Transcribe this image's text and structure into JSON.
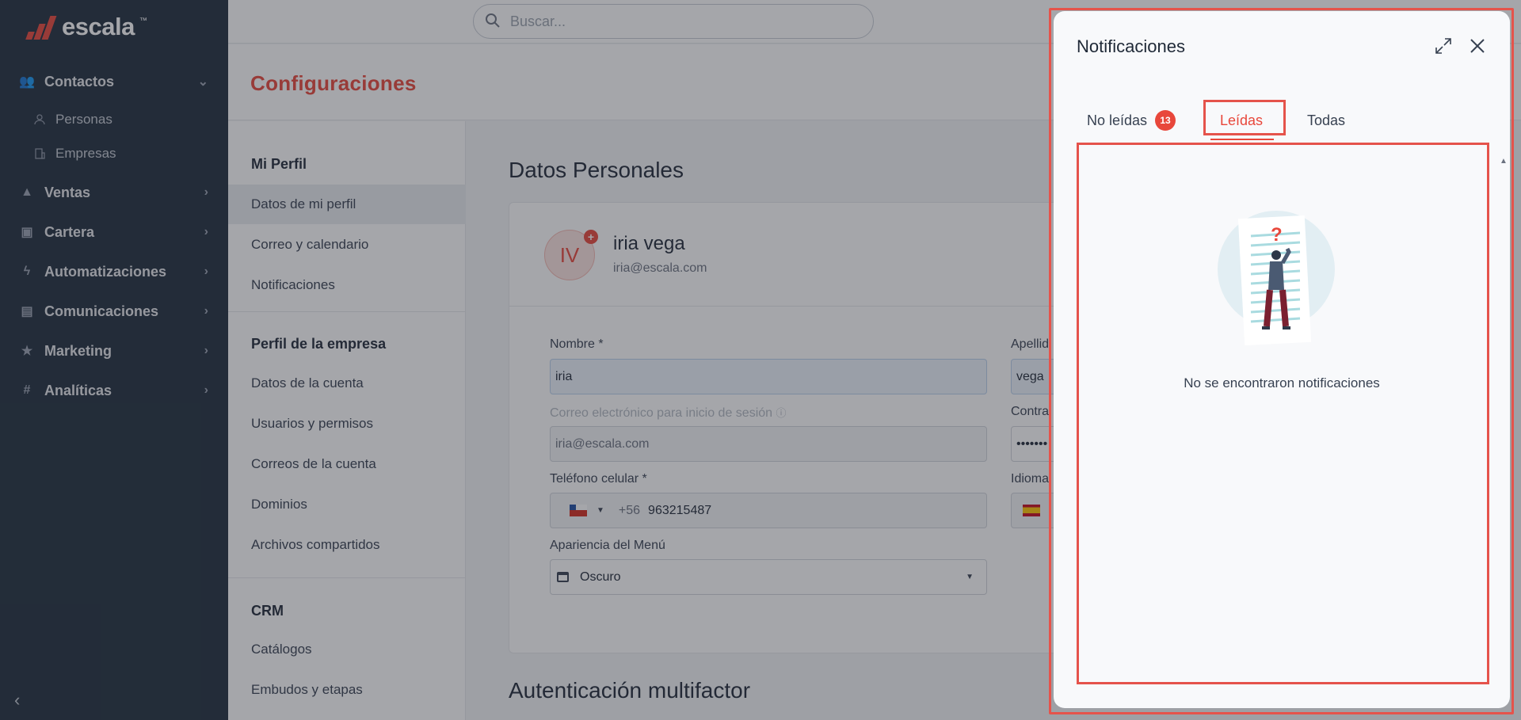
{
  "brand": {
    "name": "escala",
    "tm": "™"
  },
  "sidebar": {
    "items": [
      {
        "label": "Contactos",
        "icon": "contacts-icon"
      },
      {
        "label": "Ventas",
        "icon": "sales-icon"
      },
      {
        "label": "Cartera",
        "icon": "wallet-icon"
      },
      {
        "label": "Automatizaciones",
        "icon": "bolt-icon"
      },
      {
        "label": "Comunicaciones",
        "icon": "chat-icon"
      },
      {
        "label": "Marketing",
        "icon": "star-icon"
      },
      {
        "label": "Analíticas",
        "icon": "hash-icon"
      }
    ],
    "subitems": [
      {
        "label": "Personas",
        "icon": "person-icon"
      },
      {
        "label": "Empresas",
        "icon": "building-icon"
      }
    ]
  },
  "search": {
    "placeholder": "Buscar..."
  },
  "header": {
    "title": "Configuraciones"
  },
  "settings_nav": {
    "sections": [
      "Mi Perfil",
      "Perfil de la empresa",
      "CRM"
    ],
    "items": [
      "Datos de mi perfil",
      "Correo y calendario",
      "Notificaciones",
      "Datos de la cuenta",
      "Usuarios y permisos",
      "Correos de la cuenta",
      "Dominios",
      "Archivos compartidos",
      "Catálogos",
      "Embudos y etapas"
    ]
  },
  "content": {
    "title": "Datos Personales",
    "mfa_title": "Autenticación multifactor",
    "profile": {
      "initials": "IV",
      "name": "iria vega",
      "email": "iria@escala.com"
    },
    "fields": {
      "nombre_label": "Nombre *",
      "nombre_value": "iria",
      "apellido_label": "Apellid",
      "apellido_value": "vega",
      "correo_label": "Correo electrónico para inicio de sesión",
      "correo_value": "iria@escala.com",
      "contra_label": "Contra",
      "contra_value": "•••••••",
      "telefono_label": "Teléfono celular *",
      "telefono_code": "+56",
      "telefono_value": "963215487",
      "idioma_label": "Idioma",
      "apariencia_label": "Apariencia del Menú",
      "apariencia_value": "Oscuro"
    }
  },
  "notifications": {
    "title": "Notificaciones",
    "tabs": [
      {
        "label": "No leídas",
        "badge": "13"
      },
      {
        "label": "Leídas"
      },
      {
        "label": "Todas"
      }
    ],
    "active_tab": "Leídas",
    "empty_message": "No se encontraron notificaciones"
  },
  "colors": {
    "accent": "#e8473b",
    "sidebar": "#1f2d3d"
  }
}
